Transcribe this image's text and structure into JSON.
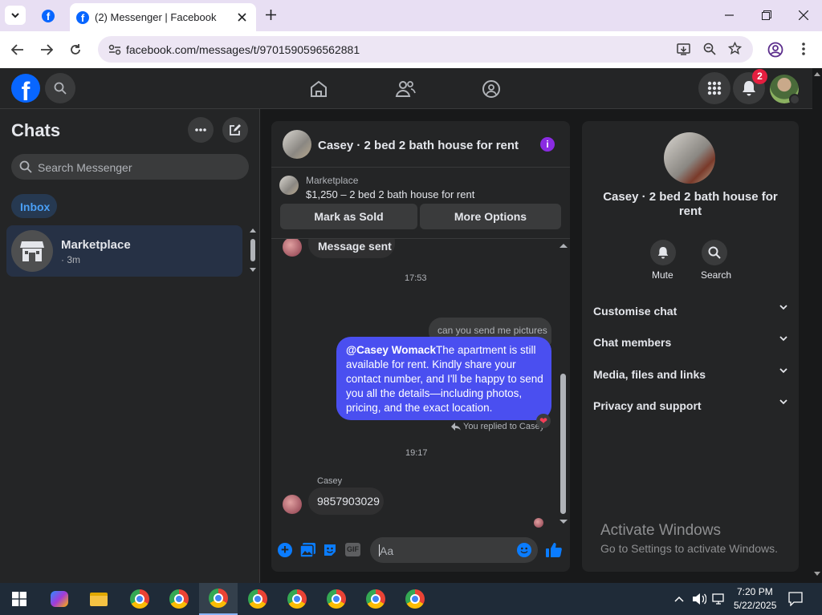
{
  "browser": {
    "tab_title": "(2) Messenger | Facebook",
    "url": "facebook.com/messages/t/9701590596562881"
  },
  "header": {
    "notification_count": "2"
  },
  "left": {
    "title": "Chats",
    "search_placeholder": "Search Messenger",
    "inbox_label": "Inbox",
    "chats": [
      {
        "name": "Marketplace",
        "time": "· 3m"
      }
    ]
  },
  "chat": {
    "title": "Casey · 2 bed 2 bath house for rent",
    "marketplace_label": "Marketplace",
    "listing": "$1,250 – 2 bed 2 bath house for rent",
    "mark_sold": "Mark as Sold",
    "more_options": "More Options",
    "messages": {
      "prev_message": "Message sent",
      "time1": "17:53",
      "replied_to": "You replied to Casey",
      "quoted": "can you send me pictures",
      "mention": "@Casey Womack",
      "sent_text": "The apartment is still available for rent. Kindly share your contact number, and I'll be happy to send you all the details—including photos, pricing, and the exact location.",
      "time2": "19:17",
      "sender": "Casey",
      "received": "9857903029"
    },
    "composer_placeholder": "Aa"
  },
  "info": {
    "title": "Casey · 2 bed 2 bath house for rent",
    "mute_label": "Mute",
    "search_label": "Search",
    "sections": [
      "Customise chat",
      "Chat members",
      "Media, files and links",
      "Privacy and support"
    ]
  },
  "watermark": {
    "line1": "Activate Windows",
    "line2": "Go to Settings to activate Windows."
  },
  "taskbar": {
    "time": "7:20 PM",
    "date": "5/22/2025"
  },
  "colors": {
    "messenger_blue": "#4a4ff0",
    "fb_blue": "#0866ff",
    "info_purple": "#8a2be2"
  }
}
